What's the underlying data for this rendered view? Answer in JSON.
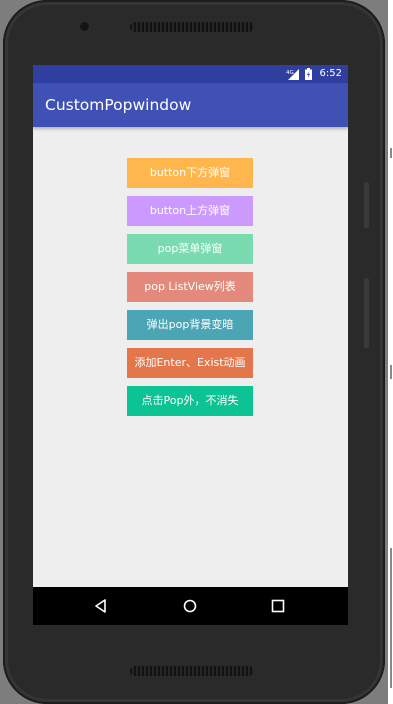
{
  "status_bar": {
    "network": "4G",
    "time": "6:52"
  },
  "app_bar": {
    "title": "CustomPopwindow"
  },
  "buttons": [
    {
      "label": "button下方弹窗",
      "color": "#ffb74d"
    },
    {
      "label": "button上方弹窗",
      "color": "#cc99ff"
    },
    {
      "label": "pop菜单弹窗",
      "color": "#7adab0"
    },
    {
      "label": "pop ListView列表",
      "color": "#e38a7c"
    },
    {
      "label": "弹出pop背景变暗",
      "color": "#4ba5b5"
    },
    {
      "label": "添加Enter、Exist动画",
      "color": "#e3764a"
    },
    {
      "label": "点击Pop外，不消失",
      "color": "#0cc393"
    }
  ],
  "nav_bar": {
    "icons": [
      "back-icon",
      "home-icon",
      "recents-icon"
    ]
  },
  "colors": {
    "status_bar": "#303f9f",
    "app_bar": "#3f51b5",
    "content_bg": "#eeeeee"
  }
}
